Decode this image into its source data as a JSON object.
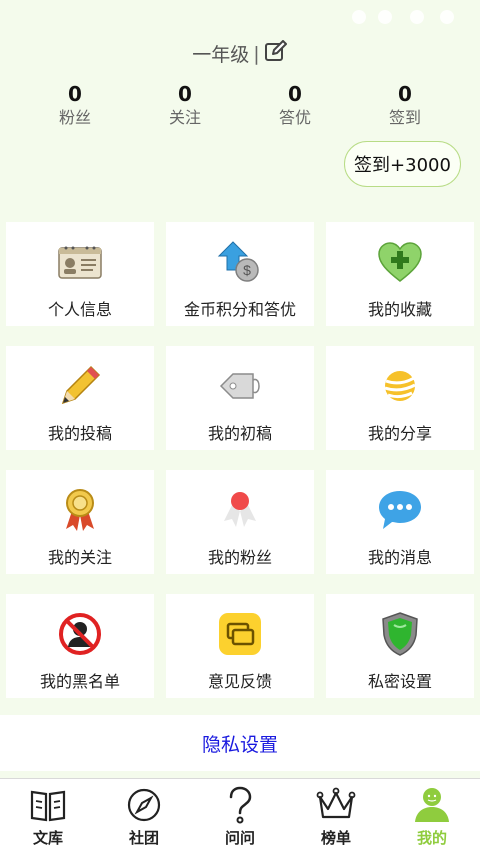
{
  "profile": {
    "grade": "一年级",
    "separator": "|"
  },
  "stats": [
    {
      "value": "0",
      "label": "粉丝"
    },
    {
      "value": "0",
      "label": "关注"
    },
    {
      "value": "0",
      "label": "答优"
    },
    {
      "value": "0",
      "label": "签到"
    }
  ],
  "checkin": {
    "label": "签到+3000"
  },
  "menu": [
    {
      "label": "个人信息",
      "icon": "id-card-icon"
    },
    {
      "label": "金币积分和答优",
      "icon": "coin-upgrade-icon"
    },
    {
      "label": "我的收藏",
      "icon": "heart-plus-icon"
    },
    {
      "label": "我的投稿",
      "icon": "pencil-icon"
    },
    {
      "label": "我的初稿",
      "icon": "price-tag-icon"
    },
    {
      "label": "我的分享",
      "icon": "share-ball-icon"
    },
    {
      "label": "我的关注",
      "icon": "award-ribbon-icon"
    },
    {
      "label": "我的粉丝",
      "icon": "fans-ribbon-icon"
    },
    {
      "label": "我的消息",
      "icon": "chat-bubble-icon"
    },
    {
      "label": "我的黑名单",
      "icon": "blocked-user-icon"
    },
    {
      "label": "意见反馈",
      "icon": "feedback-icon"
    },
    {
      "label": "私密设置",
      "icon": "shield-icon"
    }
  ],
  "privacy": {
    "label": "隐私设置"
  },
  "tabs": [
    {
      "label": "文库",
      "icon": "book-icon"
    },
    {
      "label": "社团",
      "icon": "compass-icon"
    },
    {
      "label": "问问",
      "icon": "question-icon"
    },
    {
      "label": "榜单",
      "icon": "crown-icon"
    },
    {
      "label": "我的",
      "icon": "user-icon",
      "active": true
    }
  ],
  "colors": {
    "accent": "#8fcc3e",
    "link": "#1a1adf",
    "background": "#f4fbec"
  }
}
